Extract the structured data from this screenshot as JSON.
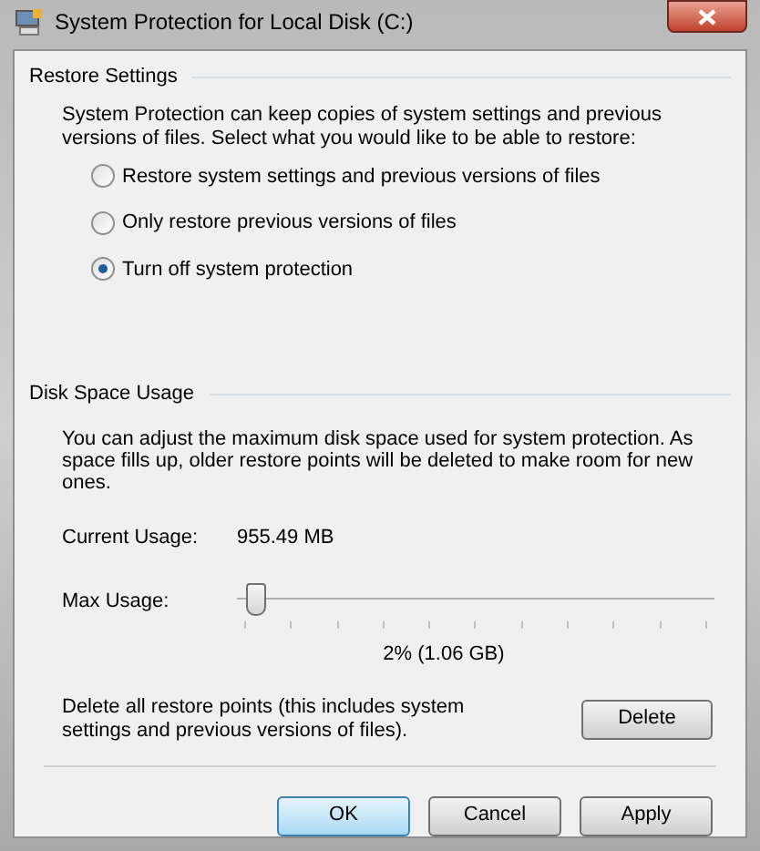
{
  "window": {
    "title": "System Protection for Local Disk (C:)"
  },
  "restore_settings": {
    "heading": "Restore Settings",
    "description": "System Protection can keep copies of system settings and previous versions of files. Select what you would like to be able to restore:",
    "options": [
      {
        "label": "Restore system settings and previous versions of files",
        "selected": false
      },
      {
        "label": "Only restore previous versions of files",
        "selected": false
      },
      {
        "label": "Turn off system protection",
        "selected": true
      }
    ]
  },
  "disk_space_usage": {
    "heading": "Disk Space Usage",
    "description": "You can adjust the maximum disk space used for system protection. As space fills up, older restore points will be deleted to make room for new ones.",
    "current_usage": {
      "label": "Current Usage:",
      "value": "955.49 MB"
    },
    "max_usage": {
      "label": "Max Usage:",
      "level": 0.02,
      "reading": "2% (1.06 GB)"
    },
    "delete": {
      "text": "Delete all restore points (this includes system settings and previous versions of files).",
      "button": "Delete"
    }
  },
  "buttons": [
    {
      "label": "OK",
      "kind": "default"
    },
    {
      "label": "Cancel",
      "kind": "normal"
    },
    {
      "label": "Apply",
      "kind": "normal"
    }
  ]
}
